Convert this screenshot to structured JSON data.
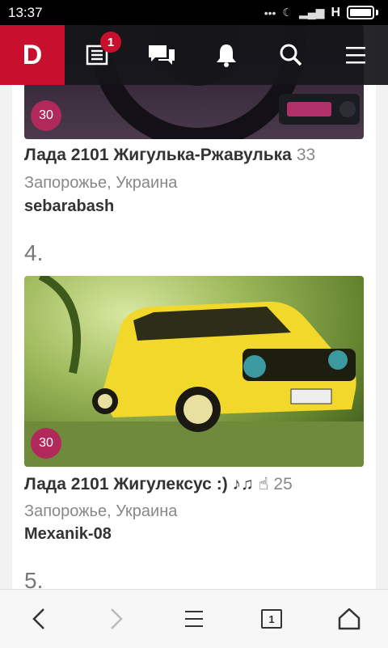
{
  "statusbar": {
    "time": "13:37",
    "network": "H"
  },
  "topnav": {
    "logo": "D",
    "feed_badge": "1"
  },
  "list": [
    {
      "score": "30",
      "title": "Лада 2101 Жигулька-Ржавулька",
      "count": "33",
      "location": "Запорожье, Украина",
      "author": "sebarabash"
    },
    {
      "rank": "4.",
      "score": "30",
      "title": "Лада 2101 Жигулексус :) ♪♫ ☝",
      "count": "25",
      "location": "Запорожье, Украина",
      "author": "Mexanik-08"
    },
    {
      "rank": "5."
    }
  ],
  "bottombar": {
    "tabs_count": "1"
  },
  "colors": {
    "brand": "#c8102e",
    "score_badge": "#b0295a",
    "car": "#f2d82a"
  }
}
